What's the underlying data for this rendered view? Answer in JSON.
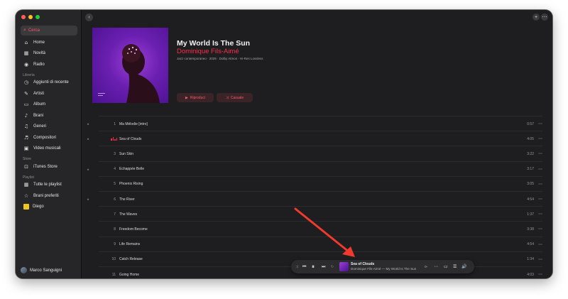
{
  "sidebar": {
    "search_label": "Cerca",
    "nav": [
      {
        "label": "Home",
        "icon": "home-icon"
      },
      {
        "label": "Novità",
        "icon": "grid-icon"
      },
      {
        "label": "Radio",
        "icon": "radio-icon"
      }
    ],
    "library_header": "Libreria",
    "library": [
      {
        "label": "Aggiunti di recente",
        "icon": "clock-icon"
      },
      {
        "label": "Artisti",
        "icon": "microphone-icon"
      },
      {
        "label": "Album",
        "icon": "album-icon"
      },
      {
        "label": "Brani",
        "icon": "note-icon"
      },
      {
        "label": "Generi",
        "icon": "genres-icon"
      },
      {
        "label": "Compositori",
        "icon": "composer-icon"
      },
      {
        "label": "Video musicali",
        "icon": "video-icon"
      }
    ],
    "store_header": "Store",
    "store": [
      {
        "label": "iTunes Store",
        "icon": "store-icon"
      }
    ],
    "playlist_header": "Playlist",
    "playlists": [
      {
        "label": "Tutte le playlist",
        "icon": "grid-icon"
      },
      {
        "label": "Brani preferiti",
        "icon": "star-icon"
      },
      {
        "label": "Diego",
        "icon": "playlist-thumb"
      }
    ],
    "user_name": "Marco Sanguigni"
  },
  "album": {
    "title": "My World Is The Sun",
    "artist": "Dominique Fils-Aimé",
    "meta": "Jazz contemporaneo · 2025 · Dolby Atmos · Hi-Res Lossless",
    "play_label": "Riproduci",
    "shuffle_label": "Casuale"
  },
  "tracks": [
    {
      "num": "1",
      "title": "Ma Mélodie [intro]",
      "duration": "0:57",
      "mark": "★"
    },
    {
      "num": "2",
      "title": "Sea of Clouds",
      "duration": "4:05",
      "mark": "★",
      "playing": true
    },
    {
      "num": "3",
      "title": "Sun Skin",
      "duration": "3:22",
      "mark": ""
    },
    {
      "num": "4",
      "title": "Echappée Belle",
      "duration": "3:17",
      "mark": "★"
    },
    {
      "num": "5",
      "title": "Phoenix Rising",
      "duration": "3:05",
      "mark": ""
    },
    {
      "num": "6",
      "title": "The River",
      "duration": "4:54",
      "mark": "★"
    },
    {
      "num": "7",
      "title": "The Waves",
      "duration": "1:37",
      "mark": ""
    },
    {
      "num": "8",
      "title": "Freedom Become",
      "duration": "3:38",
      "mark": ""
    },
    {
      "num": "9",
      "title": "Life Remains",
      "duration": "4:54",
      "mark": ""
    },
    {
      "num": "10",
      "title": "Catch Release",
      "duration": "1:34",
      "mark": ""
    },
    {
      "num": "11",
      "title": "Going Home",
      "duration": "4:03",
      "mark": ""
    }
  ],
  "player": {
    "title": "Sea of Clouds",
    "subtitle": "Dominique Fils-Aimé — My World Is The Sun"
  },
  "colors": {
    "accent": "#fa2d48",
    "background": "#1e1e20",
    "sidebar": "#262629"
  }
}
